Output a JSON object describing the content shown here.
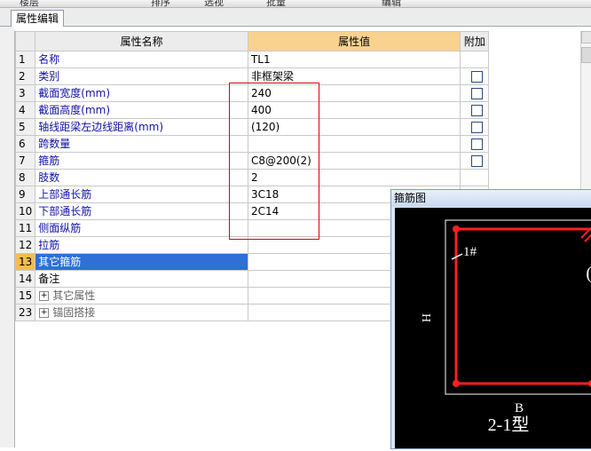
{
  "toolbar": {
    "items": [
      "楼层",
      "排序",
      "选视",
      "批量",
      "编辑"
    ]
  },
  "tab": {
    "label": "属性编辑"
  },
  "grid": {
    "headers": {
      "name": "属性名称",
      "value": "属性值",
      "extra": "附加"
    },
    "rows": [
      {
        "num": "1",
        "name": "名称",
        "value": "TL1",
        "check": false
      },
      {
        "num": "2",
        "name": "类别",
        "value": "非框架梁",
        "check": true
      },
      {
        "num": "3",
        "name": "截面宽度(mm)",
        "value": "240",
        "check": true
      },
      {
        "num": "4",
        "name": "截面高度(mm)",
        "value": "400",
        "check": true
      },
      {
        "num": "5",
        "name": "轴线距梁左边线距离(mm)",
        "value": "(120)",
        "check": true
      },
      {
        "num": "6",
        "name": "跨数量",
        "value": "",
        "check": true
      },
      {
        "num": "7",
        "name": "箍筋",
        "value": "C8@200(2)",
        "check": true
      },
      {
        "num": "8",
        "name": "肢数",
        "value": "2",
        "check": false
      },
      {
        "num": "9",
        "name": "上部通长筋",
        "value": "3C18",
        "check": false
      },
      {
        "num": "10",
        "name": "下部通长筋",
        "value": "2C14",
        "check": false
      },
      {
        "num": "11",
        "name": "侧面纵筋",
        "value": "",
        "check": false
      },
      {
        "num": "12",
        "name": "拉筋",
        "value": "",
        "check": false
      },
      {
        "num": "13",
        "name": "其它箍筋",
        "value": "",
        "check": false
      },
      {
        "num": "14",
        "name": "备注",
        "value": "",
        "check": false
      },
      {
        "num": "15",
        "name": "其它属性",
        "value": "",
        "check": false
      },
      {
        "num": "23",
        "name": "锚固搭接",
        "value": "",
        "check": false
      }
    ]
  },
  "diagram": {
    "title": "箍筋图",
    "label_bar": "1#",
    "label_h": "H",
    "label_b": "B",
    "type_label": "2-1型"
  }
}
